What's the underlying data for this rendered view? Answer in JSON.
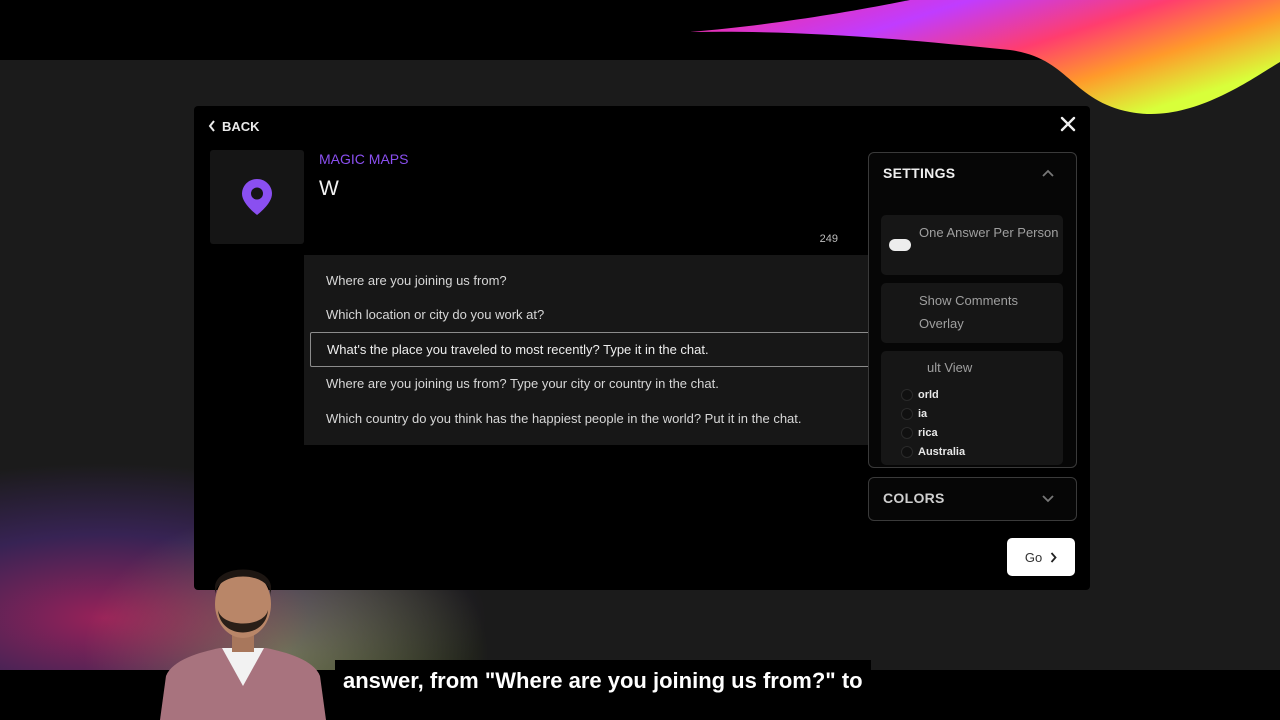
{
  "navigation": {
    "back_label": "BACK"
  },
  "activity": {
    "type_label": "MAGIC MAPS",
    "question_value": "W",
    "char_count": "249",
    "icon": "map-pin-icon",
    "accent_color": "#8a4ff0"
  },
  "suggestions": [
    {
      "text": "Where are you joining us from?"
    },
    {
      "text": "Which location or city do you work at?"
    },
    {
      "text": "What's the place you traveled to most recently? Type it in the chat."
    },
    {
      "text": "Where are you joining us from? Type your city or country in the chat."
    },
    {
      "text": "Which country do you think has the happiest people in the world? Put it in the chat."
    }
  ],
  "settings": {
    "title": "SETTINGS",
    "one_answer": "One Answer Per Person",
    "show_comments": "Show Comments Overlay",
    "result_view_label": "ult View",
    "views": [
      {
        "label": "orld"
      },
      {
        "label": "ia"
      },
      {
        "label": "rica"
      },
      {
        "label": "Australia"
      }
    ]
  },
  "colors_panel": {
    "title": "COLORS"
  },
  "go_button": {
    "label": "Go"
  },
  "caption": {
    "text": "answer, from \"Where are you joining us from?\" to"
  }
}
